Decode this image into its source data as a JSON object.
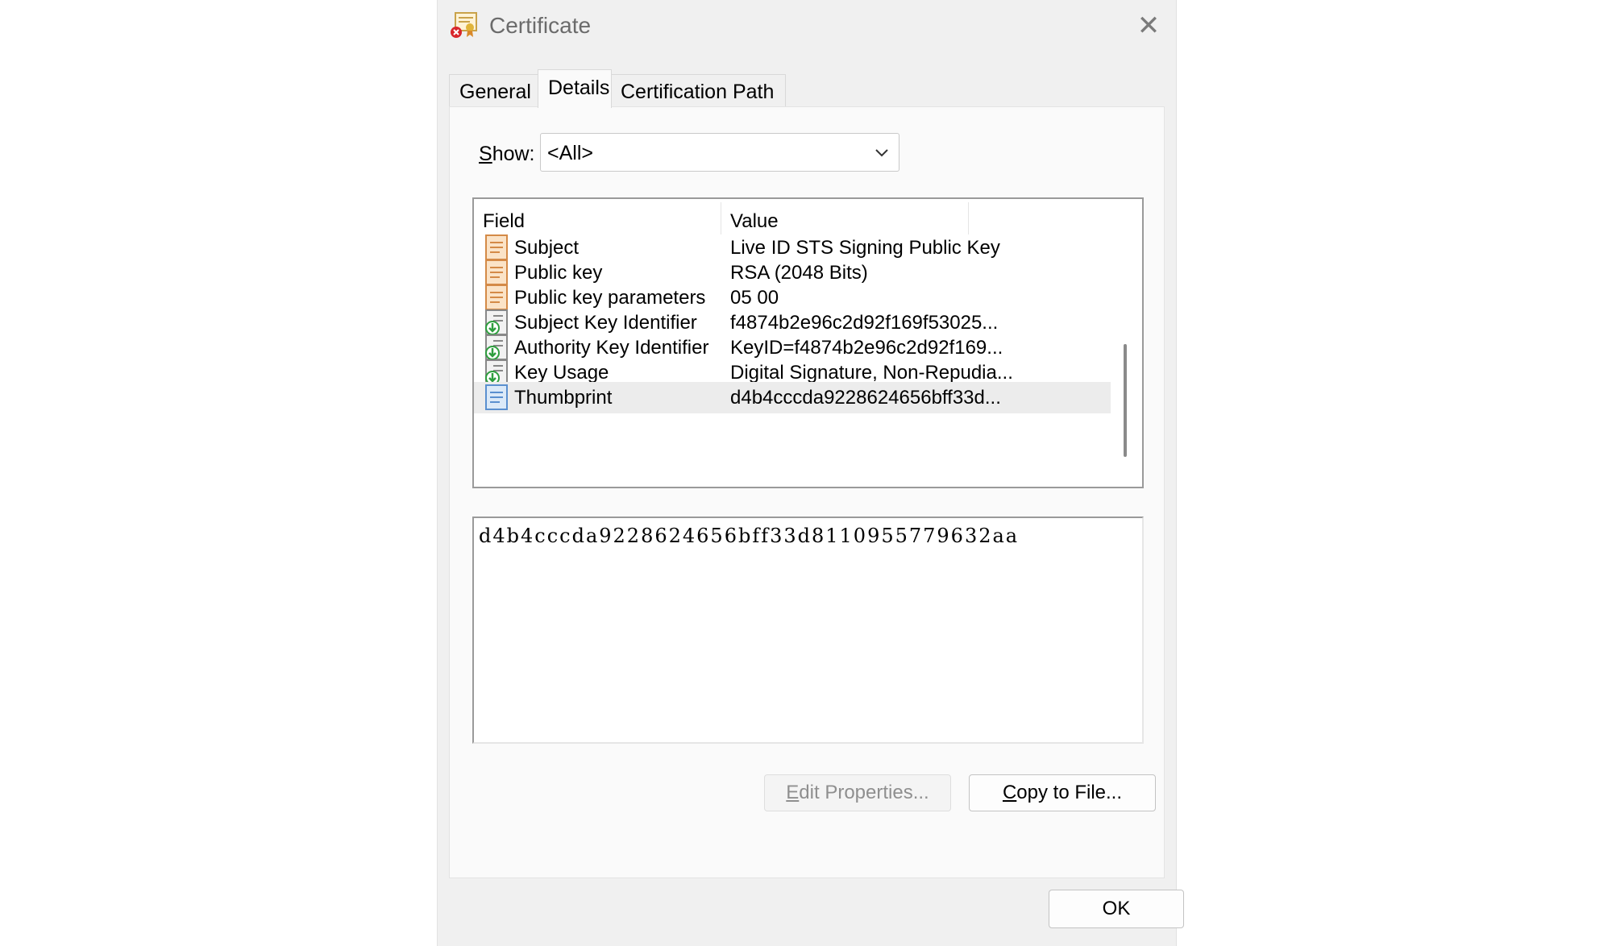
{
  "window": {
    "title": "Certificate",
    "close_glyph": "✕"
  },
  "tabs": [
    {
      "label": "General"
    },
    {
      "label": "Details",
      "active": true
    },
    {
      "label": "Certification Path"
    }
  ],
  "show": {
    "label_accel": "S",
    "label_rest": "how:",
    "value": "<All>"
  },
  "listview": {
    "columns": [
      "Field",
      "Value"
    ],
    "rows": [
      {
        "icon": "certificate-field-icon",
        "field": "Subject",
        "value": "Live ID STS Signing Public Key"
      },
      {
        "icon": "certificate-field-icon",
        "field": "Public key",
        "value": "RSA (2048 Bits)"
      },
      {
        "icon": "certificate-field-icon",
        "field": "Public key parameters",
        "value": "05 00"
      },
      {
        "icon": "certificate-extension-icon",
        "field": "Subject Key Identifier",
        "value": "f4874b2e96c2d92f169f53025..."
      },
      {
        "icon": "certificate-extension-icon",
        "field": "Authority Key Identifier",
        "value": "KeyID=f4874b2e96c2d92f169..."
      },
      {
        "icon": "certificate-extension-icon",
        "field": "Key Usage",
        "value": "Digital Signature, Non-Repudia..."
      },
      {
        "icon": "certificate-property-icon",
        "field": "Thumbprint",
        "value": "d4b4cccda9228624656bff33d...",
        "selected": true
      }
    ]
  },
  "detail_value": "d4b4cccda9228624656bff33d8110955779632aa",
  "buttons": {
    "edit_accel": "E",
    "edit_rest": "dit Properties...",
    "copy_accel": "C",
    "copy_rest": "opy to File...",
    "ok": "OK"
  },
  "colors": {
    "dialog_bg": "#f0f0f0",
    "panel_bg": "#fafafa",
    "selected_row": "#ececec",
    "field_icon": "#e8a96a",
    "property_icon": "#6a9fd8",
    "extension_arrow": "#2e9e3e"
  }
}
